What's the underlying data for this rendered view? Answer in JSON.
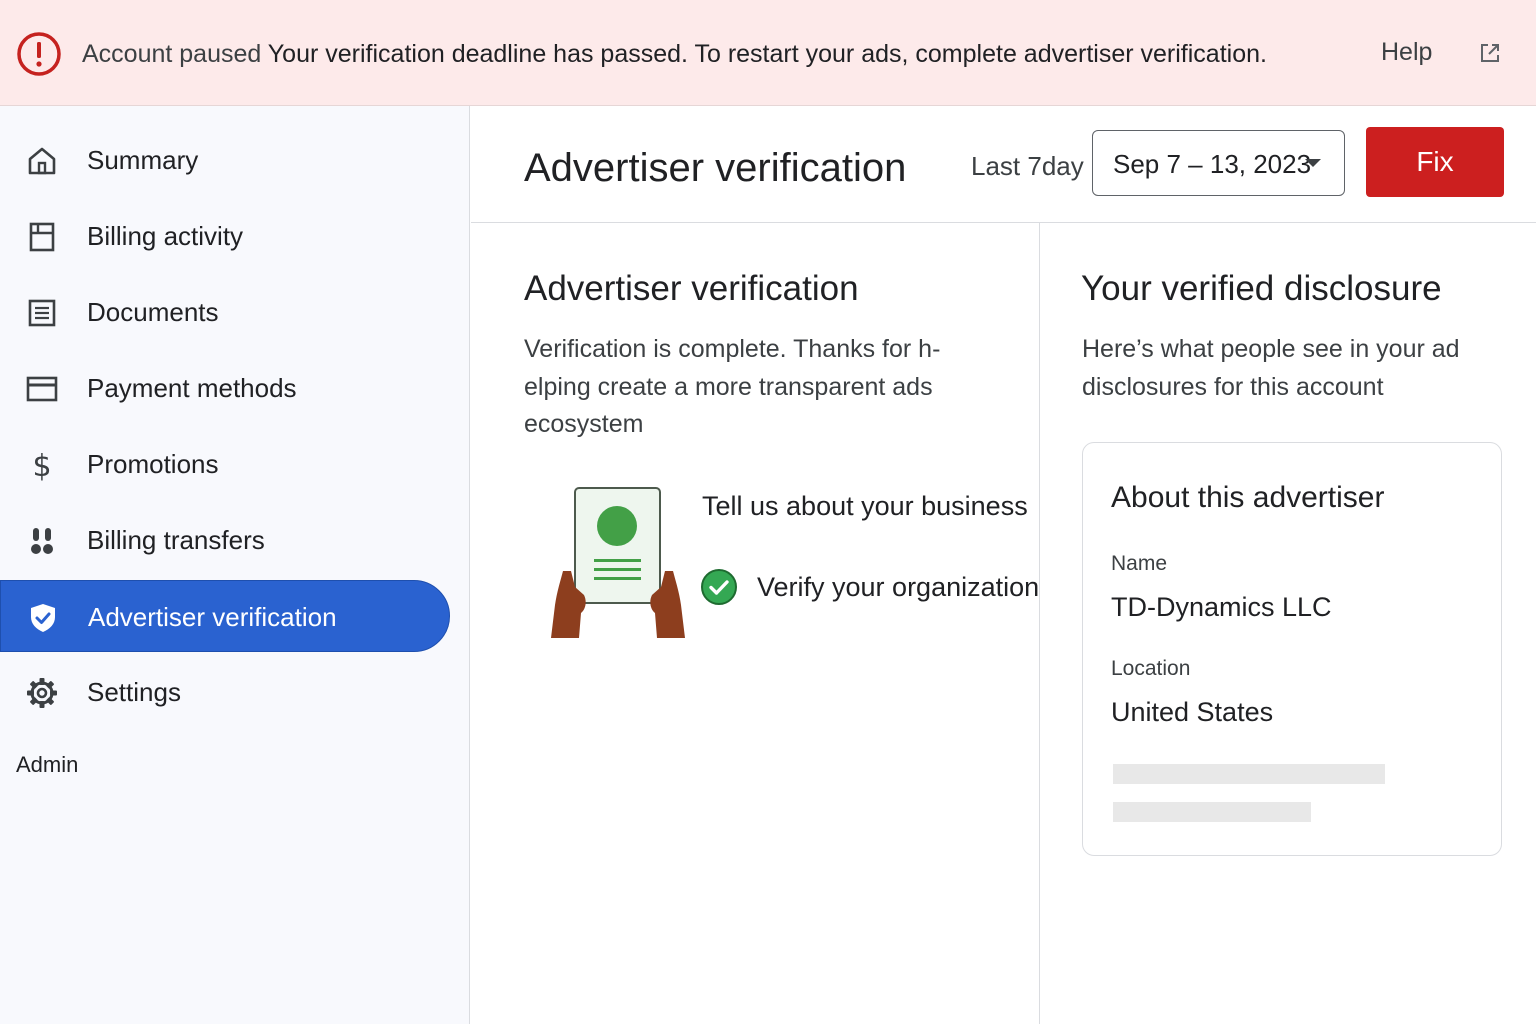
{
  "banner": {
    "status": "Account paused",
    "message": "Your verification deadline has passed. To restart your ads, complete advertiser verification.",
    "help_label": "Help",
    "status_color": "#c5221f",
    "background": "#fdeaea"
  },
  "sidebar": {
    "items": [
      {
        "label": "Summary",
        "icon": "home-icon"
      },
      {
        "label": "Billing activity",
        "icon": "receipt-icon"
      },
      {
        "label": "Documents",
        "icon": "document-icon"
      },
      {
        "label": "Payment methods",
        "icon": "credit-card-icon"
      },
      {
        "label": "Promotions",
        "icon": "dollar-icon"
      },
      {
        "label": "Billing transfers",
        "icon": "transfer-icon"
      },
      {
        "label": "Advertiser verification",
        "icon": "verified-shield-icon",
        "active": true
      },
      {
        "label": "Settings",
        "icon": "gear-icon"
      }
    ],
    "section_label": "Admin",
    "active_color": "#2a62d0"
  },
  "header": {
    "title": "Advertiser verification",
    "range_label": "Last 7day",
    "date_range": "Sep 7 – 13, 2023",
    "fix_label": "Fix",
    "fix_color": "#cc1f1f"
  },
  "verification": {
    "title": "Advertiser verification",
    "description": "Verification is complete.  Thanks for h-elping create a more transparent ads ecosystem",
    "steps": [
      {
        "label": "Tell us about your business",
        "completed": false
      },
      {
        "label": "Verify your organization",
        "completed": true
      }
    ],
    "check_color": "#34a853"
  },
  "disclosure": {
    "title": "Your verified disclosure",
    "description": "Here’s what people see in your ad disclosures for this account",
    "card": {
      "title": "About this advertiser",
      "name_label": "Name",
      "name_value": "TD-Dynamics LLC",
      "location_label": "Location",
      "location_value": "United States"
    }
  }
}
